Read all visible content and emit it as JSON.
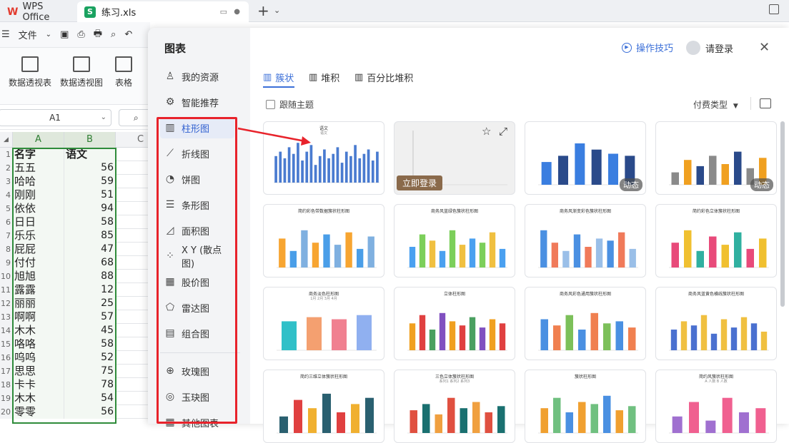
{
  "tabs": {
    "app": "WPS Office",
    "file": "练习.xls"
  },
  "toolbar": {
    "file_menu": "文件"
  },
  "ribbon": {
    "pivot_table": "数据透视表",
    "pivot_chart": "数据透视图",
    "table": "表格"
  },
  "namebox": "A1",
  "columns": [
    "A",
    "B",
    "C"
  ],
  "rows": [
    {
      "n": "1",
      "a": "名字",
      "b": "语文",
      "hdr": true
    },
    {
      "n": "2",
      "a": "五五",
      "b": "56"
    },
    {
      "n": "3",
      "a": "哈哈",
      "b": "59"
    },
    {
      "n": "4",
      "a": "刚刚",
      "b": "51"
    },
    {
      "n": "5",
      "a": "依依",
      "b": "94"
    },
    {
      "n": "6",
      "a": "日日",
      "b": "58"
    },
    {
      "n": "7",
      "a": "乐乐",
      "b": "85"
    },
    {
      "n": "8",
      "a": "屁屁",
      "b": "47"
    },
    {
      "n": "9",
      "a": "付付",
      "b": "68"
    },
    {
      "n": "10",
      "a": "旭旭",
      "b": "88"
    },
    {
      "n": "11",
      "a": "露露",
      "b": "12"
    },
    {
      "n": "12",
      "a": "丽丽",
      "b": "25"
    },
    {
      "n": "13",
      "a": "啊啊",
      "b": "57"
    },
    {
      "n": "14",
      "a": "木木",
      "b": "45"
    },
    {
      "n": "15",
      "a": "咯咯",
      "b": "58"
    },
    {
      "n": "16",
      "a": "呜呜",
      "b": "52"
    },
    {
      "n": "17",
      "a": "思思",
      "b": "75"
    },
    {
      "n": "18",
      "a": "卡卡",
      "b": "78"
    },
    {
      "n": "19",
      "a": "木木",
      "b": "54"
    },
    {
      "n": "20",
      "a": "零零",
      "b": "56"
    }
  ],
  "dialog": {
    "title": "图表",
    "tips": "操作技巧",
    "login": "请登录",
    "nav": [
      {
        "label": "我的资源",
        "icon": "person-icon"
      },
      {
        "label": "智能推荐",
        "icon": "smart-icon"
      },
      {
        "label": "柱形图",
        "icon": "bar-chart-icon",
        "active": true
      },
      {
        "label": "折线图",
        "icon": "line-chart-icon"
      },
      {
        "label": "饼图",
        "icon": "pie-chart-icon"
      },
      {
        "label": "条形图",
        "icon": "hbar-chart-icon"
      },
      {
        "label": "面积图",
        "icon": "area-chart-icon"
      },
      {
        "label": "X Y (散点图)",
        "icon": "scatter-chart-icon"
      },
      {
        "label": "股价图",
        "icon": "stock-chart-icon"
      },
      {
        "label": "雷达图",
        "icon": "radar-chart-icon"
      },
      {
        "label": "组合图",
        "icon": "combo-chart-icon"
      },
      {
        "label": "玫瑰图",
        "icon": "rose-chart-icon"
      },
      {
        "label": "玉玦图",
        "icon": "jade-chart-icon"
      },
      {
        "label": "其他图表",
        "icon": "more-chart-icon"
      }
    ],
    "subtabs": [
      "簇状",
      "堆积",
      "百分比堆积"
    ],
    "follow_theme": "跟随主题",
    "pay_type": "付费类型",
    "badge_dynamic": "动态",
    "login_now": "立即登录",
    "cards": [
      {
        "title": "语文",
        "legend": "语文"
      },
      {
        "title": "",
        "legend": ""
      },
      {
        "title": "",
        "legend": ""
      },
      {
        "title": "",
        "legend": ""
      },
      {
        "title": "简约彩色带数据簇状柱形图",
        "legend": ""
      },
      {
        "title": "商务风蓝绿色簇状柱形图",
        "legend": ""
      },
      {
        "title": "商务风渐变彩色簇状柱形图",
        "legend": ""
      },
      {
        "title": "简约彩色立体簇状柱形图",
        "legend": ""
      },
      {
        "title": "商务淡色柱形图",
        "legend": "1月 2月 3月 4月"
      },
      {
        "title": "立体柱形图",
        "legend": ""
      },
      {
        "title": "商务风彩色通用簇状柱形图",
        "legend": ""
      },
      {
        "title": "商务风蓝黄色横线簇状柱形图",
        "legend": ""
      },
      {
        "title": "简约三维立体簇状柱形图",
        "legend": ""
      },
      {
        "title": "三色立体簇状柱形图",
        "legend": "系列1 系列2 系列3"
      },
      {
        "title": "簇状柱形图",
        "legend": ""
      },
      {
        "title": "简约风簇状柱形图",
        "legend": "A 人数 B 人数"
      }
    ],
    "colors": {
      "accent": "#3b6fd8",
      "redbox": "#e8232b",
      "selection": "#2e8b3a"
    }
  }
}
